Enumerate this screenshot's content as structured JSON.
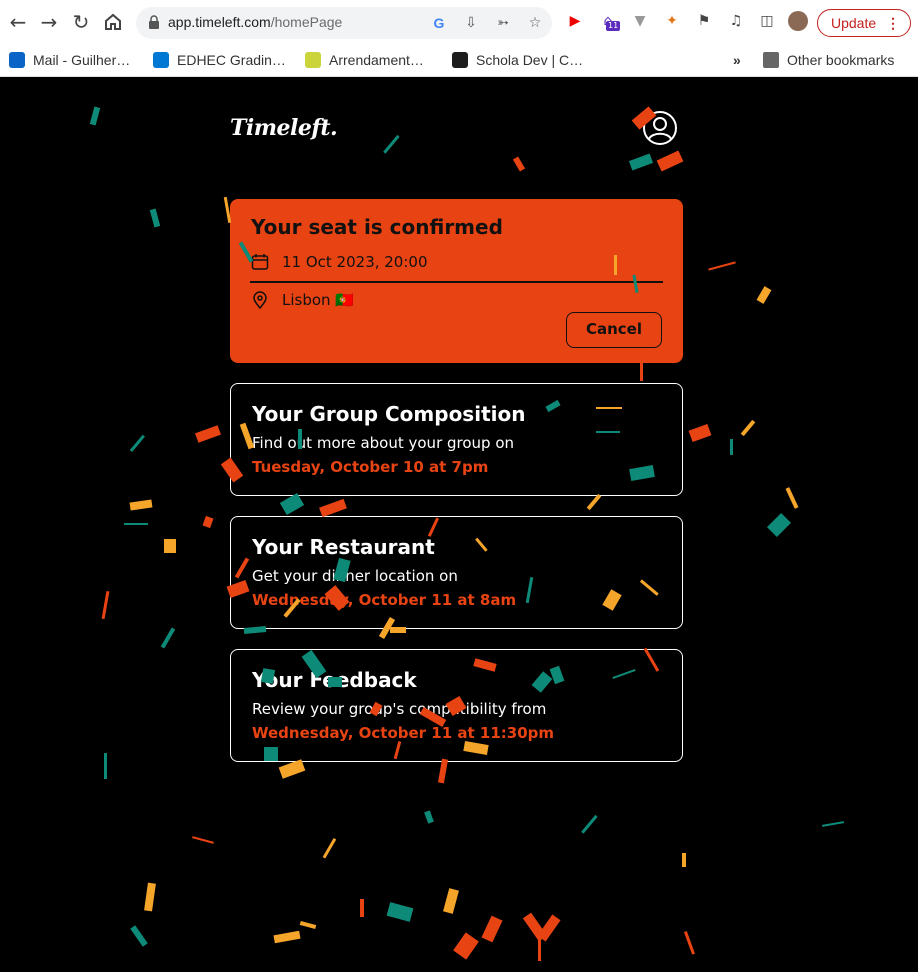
{
  "browser": {
    "url_host": "app.timeleft.com",
    "url_path": "/homePage",
    "update_label": "Update",
    "bookmarks": [
      {
        "label": "Mail - Guilher…",
        "icon": "outlook-icon",
        "color": "#0a64c8"
      },
      {
        "label": "EDHEC Gradin…",
        "icon": "azure-devops-icon",
        "color": "#0078d4"
      },
      {
        "label": "Arrendament…",
        "icon": "idealista-icon",
        "color": "#cbd43a"
      },
      {
        "label": "Schola Dev | C…",
        "icon": "react-icon",
        "color": "#1d1d1d"
      }
    ],
    "more_bookmarks": "»",
    "other_bookmarks": "Other bookmarks",
    "extension_badge": "11"
  },
  "app": {
    "logo": "Timeleft.",
    "seat": {
      "title": "Your seat is confirmed",
      "datetime": "11 Oct 2023, 20:00",
      "location": "Lisbon 🇵🇹",
      "cancel_label": "Cancel"
    },
    "cards": [
      {
        "title": "Your Group Composition",
        "text": "Find out more about your group on",
        "date": "Tuesday, October 10 at 7pm"
      },
      {
        "title": "Your Restaurant",
        "text": "Get your dinner location on",
        "date": "Wednesday, October 11 at 8am"
      },
      {
        "title": "Your Feedback",
        "text": "Review your group's compatibility from",
        "date": "Wednesday, October 11 at 11:30pm"
      }
    ]
  },
  "colors": {
    "accent": "#e84312",
    "background": "#000000",
    "confetti": [
      "#e84312",
      "#f5a52a",
      "#0d8a78"
    ]
  }
}
